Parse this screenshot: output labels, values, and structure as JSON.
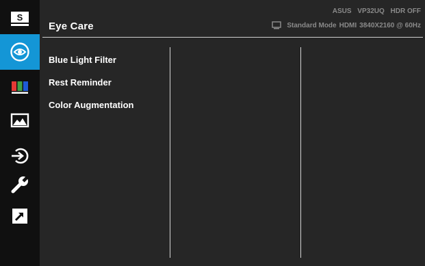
{
  "sidebar": {
    "items": [
      {
        "icon": "splendid-icon",
        "active": false
      },
      {
        "icon": "eye-care-icon",
        "active": true
      },
      {
        "icon": "color-icon",
        "active": false
      },
      {
        "icon": "image-icon",
        "active": false
      },
      {
        "icon": "input-select-icon",
        "active": false
      },
      {
        "icon": "system-setup-icon",
        "active": false
      },
      {
        "icon": "shortcut-icon",
        "active": false
      }
    ],
    "accent": "#1496d6",
    "splendid_letter": "S"
  },
  "header": {
    "title": "Eye Care",
    "brand": "ASUS",
    "model": "VP32UQ",
    "hdr": "HDR OFF",
    "mode": "Standard Mode",
    "input": "HDMI",
    "resolution": "3840X2160 @ 60Hz"
  },
  "menu": {
    "items": [
      {
        "label": "Blue Light Filter"
      },
      {
        "label": "Rest Reminder"
      },
      {
        "label": "Color Augmentation"
      }
    ]
  }
}
